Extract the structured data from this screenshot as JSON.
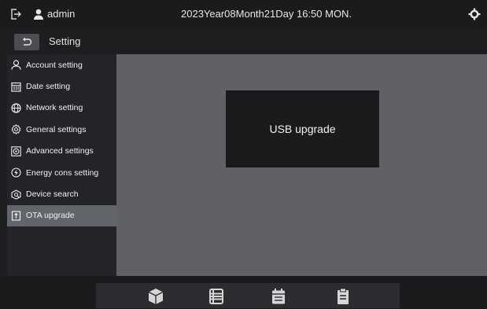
{
  "topbar": {
    "username": "admin",
    "datetime": "2023Year08Month21Day 16:50 MON."
  },
  "header": {
    "title": "Setting"
  },
  "sidebar": {
    "items": [
      {
        "label": "Account setting",
        "icon": "person-icon"
      },
      {
        "label": "Date setting",
        "icon": "calendar-icon"
      },
      {
        "label": "Network setting",
        "icon": "globe-icon"
      },
      {
        "label": "General settings",
        "icon": "gear-outline-icon"
      },
      {
        "label": "Advanced settings",
        "icon": "advanced-gear-icon"
      },
      {
        "label": "Energy cons setting",
        "icon": "energy-icon"
      },
      {
        "label": "Device search",
        "icon": "device-search-icon"
      },
      {
        "label": "OTA upgrade",
        "icon": "ota-upgrade-icon",
        "active": true
      }
    ]
  },
  "main": {
    "usb_upgrade_label": "USB upgrade"
  },
  "dock": {
    "icons": [
      "box-icon",
      "list-icon",
      "schedule-icon",
      "clipboard-icon"
    ]
  },
  "colors": {
    "background": "#1d1e20",
    "sidebar": "#232427",
    "active_item": "#62656c",
    "content": "#5f6167",
    "card": "#1b1b1d"
  }
}
